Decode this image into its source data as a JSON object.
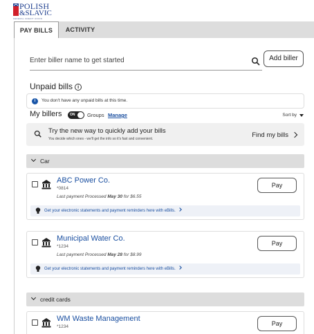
{
  "brand": {
    "name_line1": "POLISH",
    "name_line2": "&SLAVIC",
    "name_line3": "FEDERAL CREDIT UNION",
    "primary_color": "#1f3f8f",
    "accent_color": "#d11f2a"
  },
  "tabs": [
    {
      "label": "PAY BILLS",
      "active": true
    },
    {
      "label": "ACTIVITY",
      "active": false
    }
  ],
  "search": {
    "placeholder": "Enter biller name to get started",
    "value": "",
    "icon": "search-icon",
    "add_biller_label": "Add biller"
  },
  "unpaid": {
    "title": "Unpaid bills",
    "info_icon": "i",
    "message": "You don't have any unpaid bills at this time."
  },
  "my_billers": {
    "title": "My billers",
    "toggle_label": "ON",
    "groups_label": "Groups",
    "manage_label": "Manage",
    "sort_label": "Sort by"
  },
  "promo": {
    "title": "Try the new way to quickly add your bills",
    "subtitle": "You decide which ones - we'll get the info so it's fast and convenient.",
    "action_label": "Find my bills"
  },
  "groups": [
    {
      "name": "Car",
      "billers": [
        {
          "name": "ABC Power Co.",
          "account": "*0814",
          "last_payment_prefix": "Last payment Processed",
          "last_payment_date": "May 30",
          "last_payment_amount": "for $6.55",
          "pay_label": "Pay",
          "ebill_text": "Get your electronic statements and payment reminders here with eBills."
        },
        {
          "name": "Municipal Water Co.",
          "account": "*1234",
          "last_payment_prefix": "Last payment Processed",
          "last_payment_date": "May 28",
          "last_payment_amount": "for $8.99",
          "pay_label": "Pay",
          "ebill_text": "Get your electronic statements and payment reminders here with eBills."
        }
      ]
    },
    {
      "name": "credit cards",
      "billers": [
        {
          "name": "WM Waste Management",
          "account": "*1234",
          "pay_label": "Pay"
        }
      ]
    }
  ]
}
